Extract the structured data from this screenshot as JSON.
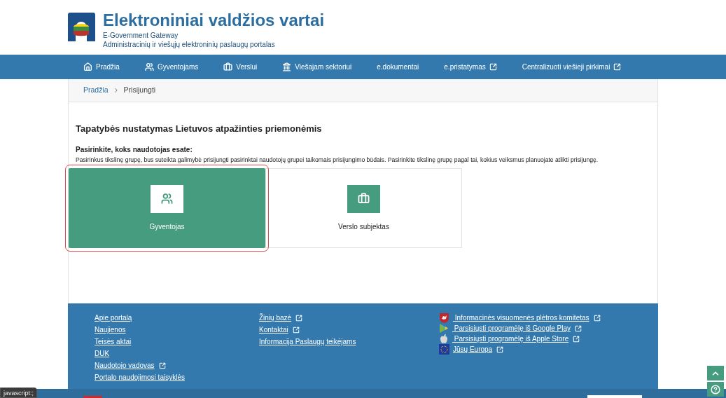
{
  "header": {
    "title": "Elektroniniai valdžios vartai",
    "subtitle": "E-Government Gateway",
    "tagline": "Administracinių ir viešųjų elektroninių paslaugų portalas"
  },
  "nav": [
    {
      "label": "Pradžia",
      "kind": "home",
      "external": false
    },
    {
      "label": "Gyventojams",
      "kind": "people",
      "external": false
    },
    {
      "label": "Verslui",
      "kind": "briefcase",
      "external": false
    },
    {
      "label": "Viešajam sektoriui",
      "kind": "institution",
      "external": false
    },
    {
      "label": "e.dokumentai",
      "kind": "none",
      "external": false
    },
    {
      "label": "e.pristatymas",
      "kind": "none",
      "external": true
    },
    {
      "label": "Centralizuoti viešieji pirkimai",
      "kind": "none",
      "external": true
    }
  ],
  "breadcrumb": [
    {
      "label": "Pradžia",
      "link": true
    },
    {
      "label": "Prisijungti",
      "link": false
    }
  ],
  "heading": "Tapatybės nustatymas Lietuvos atpažinties priemonėmis",
  "prompt": "Pasirinkite, koks naudotojas esate:",
  "description": "Pasirinkus tikslinę grupę, bus suteikta galimybė prisijungti pasirinktai naudotojų grupei taikomais prisijungimo būdais. Pasirinkite tikslinę grupę pagal tai, kokius veiksmus planuojate atlikti prisijungę.",
  "options": [
    {
      "label": "Gyventojas",
      "kind": "people",
      "selected": true
    },
    {
      "label": "Verslo subjektas",
      "kind": "briefcase",
      "selected": false
    }
  ],
  "footer": {
    "columns": [
      [
        {
          "label": "Apie portalą",
          "external": false
        },
        {
          "label": "Naujienos",
          "external": false
        },
        {
          "label": "Teisės aktai",
          "external": false
        },
        {
          "label": "DUK",
          "external": false
        },
        {
          "label": "Naudotojo vadovas",
          "external": true
        },
        {
          "label": "Portalo naudojimosi taisyklės",
          "external": false
        }
      ],
      [
        {
          "label": "Žinių bazė",
          "external": true
        },
        {
          "label": "Kontaktai",
          "external": true
        },
        {
          "label": "Informacija Paslaugų teikėjams",
          "external": false
        }
      ],
      [
        {
          "label": " Informacinės visuomenės plėtros komitetas",
          "external": true,
          "kind": "coat_of_arms"
        },
        {
          "label": " Parsisiųsti programėlę iš Google Play",
          "external": true,
          "kind": "play"
        },
        {
          "label": " Parsisiųsti programėlę iš Apple Store",
          "external": true,
          "kind": "apple"
        },
        {
          "label": "Jūsų Europa",
          "external": true,
          "kind": "eu_flag"
        }
      ]
    ]
  },
  "status_tooltip": "javascript:;"
}
